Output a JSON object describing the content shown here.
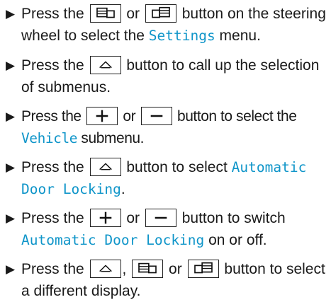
{
  "steps": [
    {
      "parts": [
        {
          "t": "Press the "
        },
        {
          "k": "page-back"
        },
        {
          "t": " or "
        },
        {
          "k": "page-forward"
        },
        {
          "t": " button on the steering wheel to select the "
        },
        {
          "d": "Settings"
        },
        {
          "t": " menu."
        }
      ]
    },
    {
      "parts": [
        {
          "t": "Press the "
        },
        {
          "k": "home"
        },
        {
          "t": " button to call up the selection of submenus."
        }
      ]
    },
    {
      "tight": true,
      "parts": [
        {
          "t": "Press the "
        },
        {
          "k": "plus"
        },
        {
          "t": " or "
        },
        {
          "k": "minus"
        },
        {
          "t": " button to select the "
        },
        {
          "d": "Vehicle"
        },
        {
          "t": " submenu."
        }
      ]
    },
    {
      "parts": [
        {
          "t": "Press the "
        },
        {
          "k": "home"
        },
        {
          "t": " button to select "
        },
        {
          "d": "Automatic Door Locking"
        },
        {
          "t": "."
        }
      ]
    },
    {
      "parts": [
        {
          "t": "Press the "
        },
        {
          "k": "plus"
        },
        {
          "t": " or "
        },
        {
          "k": "minus"
        },
        {
          "t": " button to switch "
        },
        {
          "d": "Automatic Door Locking"
        },
        {
          "t": " on or off."
        }
      ]
    },
    {
      "parts": [
        {
          "t": "Press the "
        },
        {
          "k": "home"
        },
        {
          "t": ", "
        },
        {
          "k": "page-back"
        },
        {
          "t": " or "
        },
        {
          "k": "page-forward"
        },
        {
          "t": " button to select a different display."
        }
      ]
    }
  ]
}
